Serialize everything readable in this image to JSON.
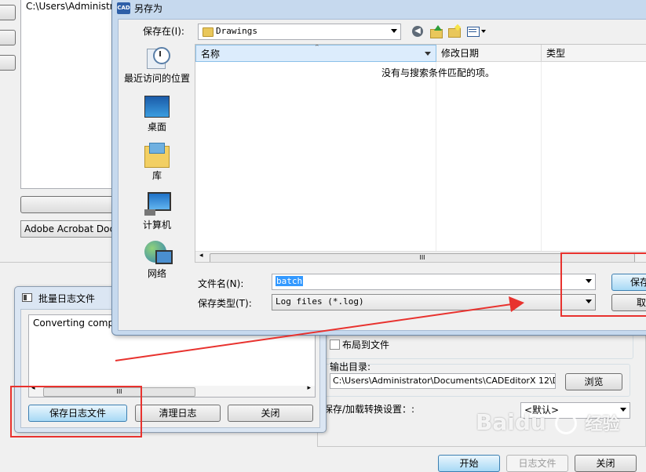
{
  "background": {
    "path_text": "C:\\Users\\Administra",
    "pdf_combo": "Adobe Acrobat Docu",
    "layout_to_file_label": "布局到文件",
    "output_dir_label": "输出目录:",
    "output_dir_value": "C:\\Users\\Administrator\\Documents\\CADEditorX 12\\D",
    "browse_label": "浏览",
    "save_load_label": "保存/加载转换设置：:",
    "default_option": "<默认>",
    "start_label": "开始",
    "log_file_label": "日志文件",
    "close_label": "关闭"
  },
  "log_dialog": {
    "title": "批量日志文件",
    "text": "Converting comple",
    "save_label": "保存日志文件",
    "clear_label": "清理日志",
    "close_label": "关闭"
  },
  "save_dialog": {
    "app_badge": "CAD",
    "title": "另存为",
    "save_in_label": "保存在(I):",
    "folder_name": "Drawings",
    "places": [
      {
        "label": "最近访问的位置",
        "icon": "recent-places-icon"
      },
      {
        "label": "桌面",
        "icon": "desktop-icon"
      },
      {
        "label": "库",
        "icon": "library-icon"
      },
      {
        "label": "计算机",
        "icon": "computer-icon"
      },
      {
        "label": "网络",
        "icon": "network-icon"
      }
    ],
    "columns": [
      "名称",
      "修改日期",
      "类型"
    ],
    "empty_text": "没有与搜索条件匹配的项。",
    "scroll_grip": "III",
    "filename_label": "文件名(N):",
    "filename_value": "batch",
    "filetype_label": "保存类型(T):",
    "filetype_value": "Log files (*.log)",
    "save_button": "保存",
    "cancel_button": "取"
  },
  "watermark": {
    "brand": "Baidu",
    "suffix": "经验"
  },
  "colors": {
    "annotation_red": "#e8322e",
    "selection_blue": "#3399ff",
    "header_blue": "#dcecfc"
  }
}
